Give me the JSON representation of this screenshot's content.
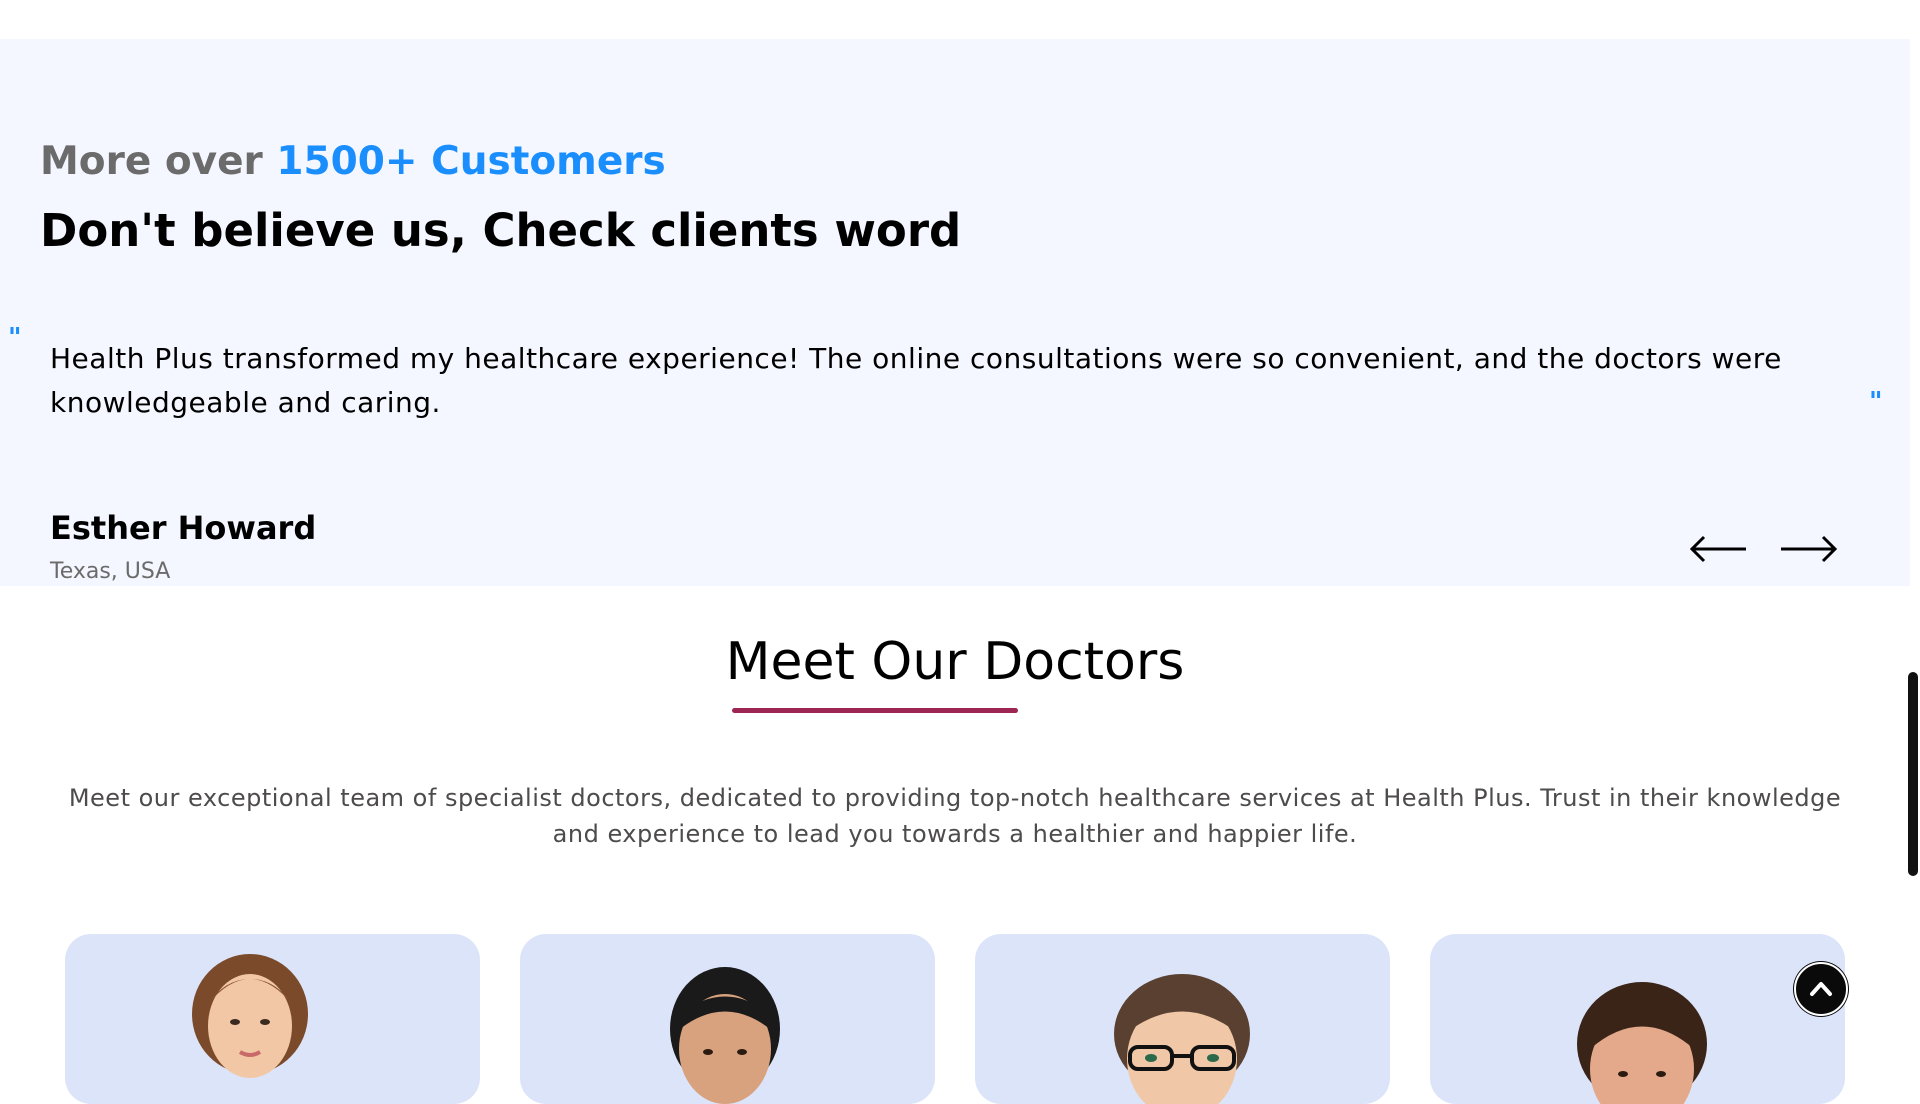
{
  "testimonials": {
    "subtitle_prefix": "More over ",
    "subtitle_accent": "1500+ Customers",
    "title": "Don't believe us, Check clients word",
    "quote_open": "\"",
    "quote_close": "\"",
    "quote": "Health Plus transformed my healthcare experience! The online consultations were so convenient, and the doctors were knowledgeable and caring.",
    "author_name": "Esther Howard",
    "author_location": "Texas, USA",
    "prev_icon": "arrow-left-icon",
    "next_icon": "arrow-right-icon",
    "accent_color": "#1a8efd"
  },
  "doctors": {
    "title": "Meet Our Doctors",
    "underline_color": "#9d2553",
    "description": "Meet our exceptional team of specialist doctors, dedicated to providing top-notch healthcare services at Health Plus. Trust in their knowledge and experience to lead you towards a healthier and happier life.",
    "card_color": "#dce4f9",
    "cards": [
      {
        "photo": "doctor-photo-1"
      },
      {
        "photo": "doctor-photo-2"
      },
      {
        "photo": "doctor-photo-3"
      },
      {
        "photo": "doctor-photo-4"
      }
    ]
  },
  "back_to_top": {
    "icon": "chevron-up-icon"
  }
}
